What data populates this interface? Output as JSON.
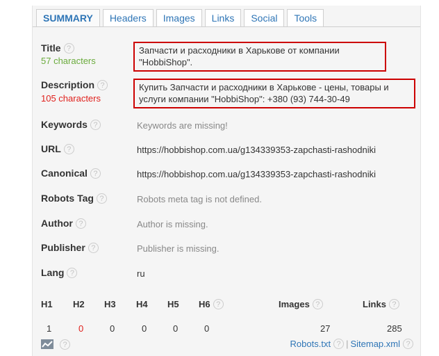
{
  "tabs": [
    "SUMMARY",
    "Headers",
    "Images",
    "Links",
    "Social",
    "Tools"
  ],
  "help_glyph": "?",
  "fields": {
    "title": {
      "label": "Title",
      "count": "57 characters",
      "value": "Запчасти и расходники в Харькове от компании \"HobbiShop\"."
    },
    "description": {
      "label": "Description",
      "count": "105 characters",
      "value": "Купить Запчасти и расходники в Харькове - цены, товары и услуги компании \"HobbiShop\": +380 (93) 744-30-49"
    },
    "keywords": {
      "label": "Keywords",
      "value": "Keywords are missing!"
    },
    "url": {
      "label": "URL",
      "value": "https://hobbishop.com.ua/g134339353-zapchasti-rashodniki"
    },
    "canonical": {
      "label": "Canonical",
      "value": "https://hobbishop.com.ua/g134339353-zapchasti-rashodniki"
    },
    "robots_tag": {
      "label": "Robots Tag",
      "value": "Robots meta tag is not defined."
    },
    "author": {
      "label": "Author",
      "value": "Author is missing."
    },
    "publisher": {
      "label": "Publisher",
      "value": "Publisher is missing."
    },
    "lang": {
      "label": "Lang",
      "value": "ru"
    }
  },
  "headings": {
    "labels": [
      "H1",
      "H2",
      "H3",
      "H4",
      "H5",
      "H6"
    ],
    "values": [
      "1",
      "0",
      "0",
      "0",
      "0",
      "0"
    ],
    "images_label": "Images",
    "images_value": "27",
    "links_label": "Links",
    "links_value": "285"
  },
  "footer": {
    "robots_link": "Robots.txt",
    "separator": "|",
    "sitemap_link": "Sitemap.xml"
  },
  "colors": {
    "accent": "#2e75b6",
    "ok": "#6aab3c",
    "error": "#e0201c",
    "highlight_box": "#cc0000"
  }
}
